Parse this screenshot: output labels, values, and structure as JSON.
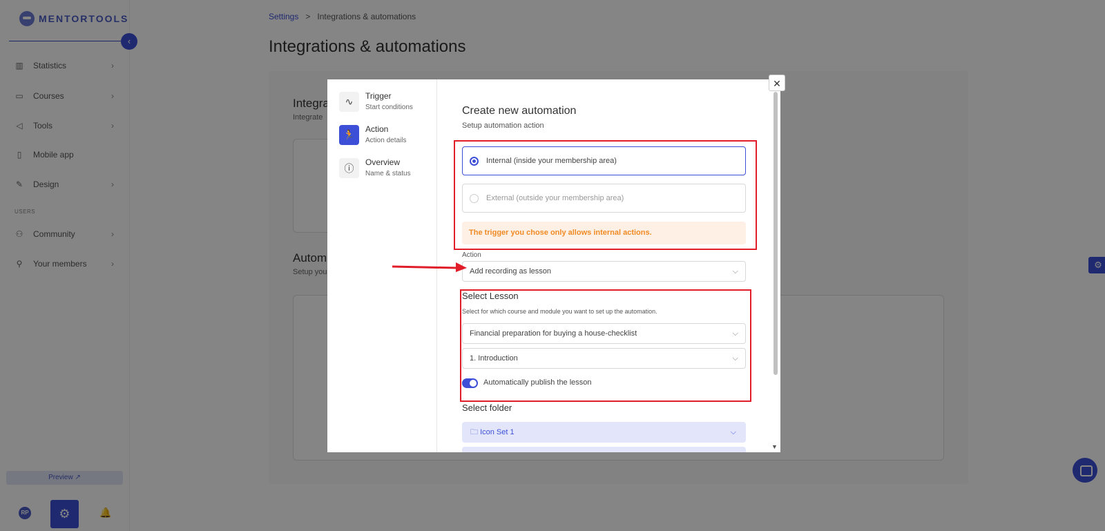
{
  "app": {
    "brand": "MENTORTOOLS",
    "collapse_icon": "‹"
  },
  "sidebar": {
    "items": [
      {
        "label": "Statistics",
        "icon": "bar-chart-icon",
        "glyph": "▥",
        "chevron": "›"
      },
      {
        "label": "Courses",
        "icon": "book-icon",
        "glyph": "▭",
        "chevron": "›"
      },
      {
        "label": "Tools",
        "icon": "megaphone-icon",
        "glyph": "◁",
        "chevron": "›"
      },
      {
        "label": "Mobile app",
        "icon": "phone-icon",
        "glyph": "▯",
        "chevron": ""
      },
      {
        "label": "Design",
        "icon": "pen-icon",
        "glyph": "✎",
        "chevron": "›"
      }
    ],
    "section_users": "USERS",
    "user_items": [
      {
        "label": "Community",
        "icon": "people-icon",
        "glyph": "⚇",
        "chevron": "›"
      },
      {
        "label": "Your members",
        "icon": "user-icon",
        "glyph": "⚲",
        "chevron": "›"
      }
    ],
    "preview_label": "Preview ↗",
    "avatar_initials": "RP",
    "gear_glyph": "⚙",
    "bell_glyph": "🔔"
  },
  "breadcrumb": {
    "parent": "Settings",
    "separator": ">",
    "current": "Integrations & automations"
  },
  "page": {
    "title": "Integrations & automations",
    "card1_title": "Integra",
    "card1_sub": "Integrate",
    "card2_title": "Autom",
    "card2_sub": "Setup you"
  },
  "modal": {
    "close_glyph": "✕",
    "steps": [
      {
        "title": "Trigger",
        "sub": "Start conditions",
        "glyph": "∿"
      },
      {
        "title": "Action",
        "sub": "Action details",
        "glyph": "🏃"
      },
      {
        "title": "Overview",
        "sub": "Name & status",
        "glyph": "ⓘ"
      }
    ],
    "title": "Create new automation",
    "subtitle": "Setup automation action",
    "option_internal": "Internal (inside your membership area)",
    "option_external": "External (outside your membership area)",
    "warning": "The trigger you chose only allows internal actions.",
    "action_label": "Action",
    "action_value": "Add recording as lesson",
    "select_lesson_title": "Select Lesson",
    "select_lesson_sub": "Select for which course and module you want to set up the automation.",
    "course_value": "Financial preparation for buying a house-checklist",
    "module_value": "1. Introduction",
    "auto_publish_label": "Automatically publish the lesson",
    "auto_publish_on": true,
    "select_folder_title": "Select folder",
    "folder_value": "Icon Set 1",
    "folder_glyph": "🗀",
    "dropdown_glyph": "⌵",
    "scroll_down_glyph": "▼"
  },
  "colors": {
    "accent": "#3d4fd6",
    "warning_bg": "#fff0e6",
    "warning_text": "#f08a24",
    "annotation": "#e11d2a"
  }
}
